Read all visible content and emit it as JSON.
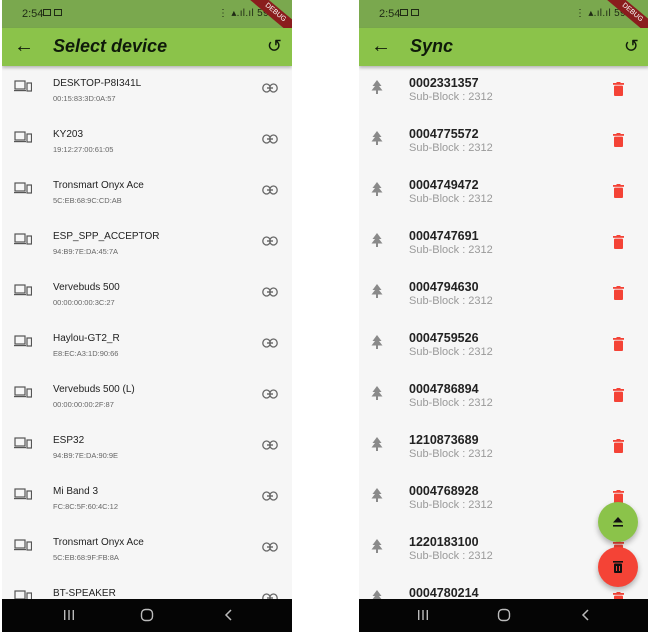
{
  "left_screen": {
    "status_bar": {
      "time": "2:54",
      "right_text": "59%",
      "debug_ribbon": "DEBUG"
    },
    "app_bar": {
      "title": "Select device",
      "back_icon": "arrow-left-icon",
      "refresh_icon": "refresh-icon"
    },
    "devices": [
      {
        "name": "DESKTOP-P8I341L",
        "mac": "00:15:83:3D:0A:57"
      },
      {
        "name": "KY203",
        "mac": "19:12:27:00:61:05"
      },
      {
        "name": "Tronsmart Onyx Ace",
        "mac": "5C:EB:68:9C:CD:AB"
      },
      {
        "name": "ESP_SPP_ACCEPTOR",
        "mac": "94:B9:7E:DA:45:7A"
      },
      {
        "name": "Vervebuds 500",
        "mac": "00:00:00:00:3C:27"
      },
      {
        "name": "Haylou-GT2_R",
        "mac": "E8:EC:A3:1D:90:66"
      },
      {
        "name": "Vervebuds 500 (L)",
        "mac": "00:00:00:00:2F:87"
      },
      {
        "name": "ESP32",
        "mac": "94:B9:7E:DA:90:9E"
      },
      {
        "name": "Mi Band 3",
        "mac": "FC:8C:5F:60:4C:12"
      },
      {
        "name": "Tronsmart Onyx Ace",
        "mac": "5C:EB:68:9F:FB:8A"
      },
      {
        "name": "BT-SPEAKER",
        "mac": ""
      }
    ]
  },
  "right_screen": {
    "status_bar": {
      "time": "2:54",
      "right_text": "59%",
      "debug_ribbon": "DEBUG"
    },
    "app_bar": {
      "title": "Sync",
      "back_icon": "arrow-left-icon",
      "refresh_icon": "refresh-icon"
    },
    "items": [
      {
        "id": "0002331357",
        "sub": "Sub-Block : 2312"
      },
      {
        "id": "0004775572",
        "sub": "Sub-Block : 2312"
      },
      {
        "id": "0004749472",
        "sub": "Sub-Block : 2312"
      },
      {
        "id": "0004747691",
        "sub": "Sub-Block : 2312"
      },
      {
        "id": "0004794630",
        "sub": "Sub-Block : 2312"
      },
      {
        "id": "0004759526",
        "sub": "Sub-Block : 2312"
      },
      {
        "id": "0004786894",
        "sub": "Sub-Block : 2312"
      },
      {
        "id": "1210873689",
        "sub": "Sub-Block : 2312"
      },
      {
        "id": "0004768928",
        "sub": "Sub-Block : 2312"
      },
      {
        "id": "1220183100",
        "sub": "Sub-Block : 2312"
      },
      {
        "id": "0004780214",
        "sub": ""
      }
    ],
    "fab_upload_icon": "upload-icon",
    "fab_delete_icon": "delete-icon"
  },
  "colors": {
    "app_bar": "#8bc34a",
    "status_bar": "#7aa84e",
    "delete_red": "#f44336",
    "nav_bar": "#050505"
  }
}
